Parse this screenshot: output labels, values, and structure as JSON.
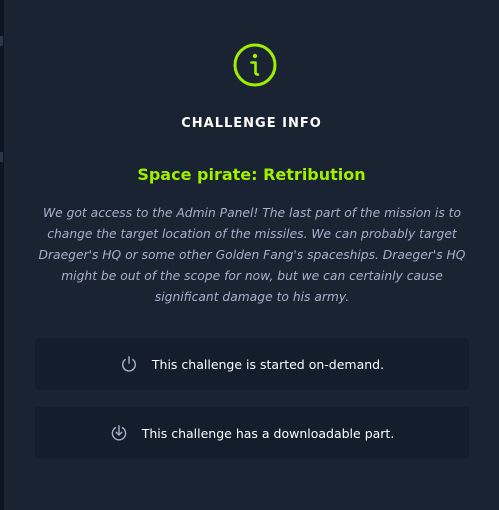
{
  "modal": {
    "title": "CHALLENGE INFO",
    "icon": "info-circle-icon",
    "challenge_name": "Space pirate: Retribution",
    "description": "We got access to the Admin Panel! The last part of the mission is to change the target location of the missiles. We can probably target Draeger's HQ or some other Golden Fang's spaceships. Draeger's HQ might be out of the scope for now, but we can certainly cause significant damage to his army."
  },
  "cards": {
    "on_demand": {
      "icon": "power-icon",
      "text": "This challenge is started on-demand."
    },
    "downloadable": {
      "icon": "download-icon",
      "text": "This challenge has a downloadable part."
    }
  },
  "colors": {
    "accent": "#9fef00",
    "modal_bg": "#1a2332",
    "card_bg": "#141d2b",
    "description": "#a4b1cd",
    "icon_muted": "#a4b1cd"
  }
}
